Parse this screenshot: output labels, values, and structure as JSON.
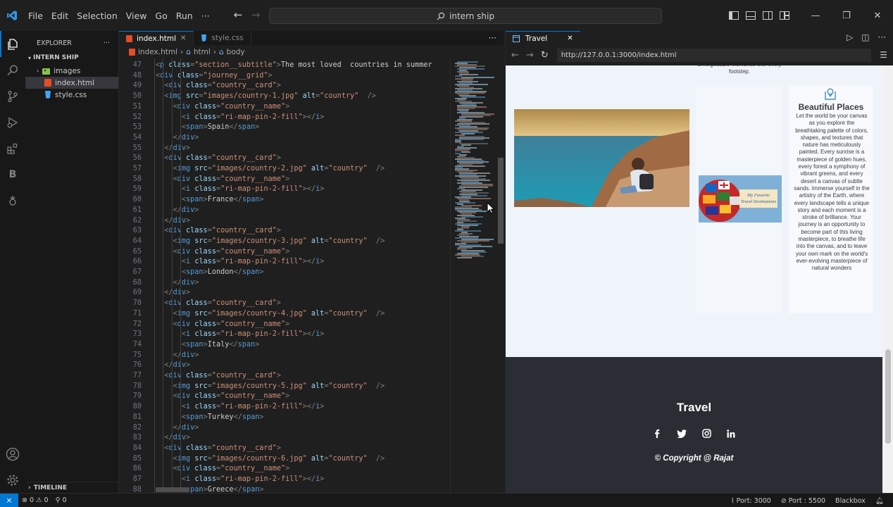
{
  "menu": [
    "File",
    "Edit",
    "Selection",
    "View",
    "Go",
    "Run",
    "···"
  ],
  "command_center": "intern ship",
  "explorer": {
    "title": "EXPLORER",
    "section": "INTERN SHIP",
    "items": [
      {
        "name": "images",
        "type": "folder"
      },
      {
        "name": "index.html",
        "type": "html"
      },
      {
        "name": "style.css",
        "type": "css"
      }
    ],
    "timeline": "TIMELINE"
  },
  "editor": {
    "tabs": [
      {
        "label": "index.html",
        "active": true
      },
      {
        "label": "style.css",
        "active": false
      }
    ],
    "breadcrumb": [
      "index.html",
      "html",
      "body"
    ],
    "lines": [
      {
        "n": "47",
        "i": 3,
        "t": "<p class=\"section__subtitle\">The most loved  countries in summer"
      },
      {
        "n": "48",
        "i": 3,
        "t": "<div class=\"journey__grid\">"
      },
      {
        "n": "49",
        "i": 4,
        "t": "<div class=\"country__card\">"
      },
      {
        "n": "50",
        "i": 4,
        "t": "<img src=\"images/country-1.jpg\" alt=\"country\" />"
      },
      {
        "n": "51",
        "i": 5,
        "t": "<div class=\"country__name\">"
      },
      {
        "n": "52",
        "i": 6,
        "t": "<i class=\"ri-map-pin-2-fill\"></i>"
      },
      {
        "n": "53",
        "i": 6,
        "t": "<span>Spain</span>"
      },
      {
        "n": "54",
        "i": 5,
        "t": "</div>"
      },
      {
        "n": "55",
        "i": 4,
        "t": "</div>"
      },
      {
        "n": "56",
        "i": 4,
        "t": "<div class=\"country__card\">"
      },
      {
        "n": "57",
        "i": 5,
        "t": "<img src=\"images/country-2.jpg\" alt=\"country\" />"
      },
      {
        "n": "58",
        "i": 5,
        "t": "<div class=\"country__name\">"
      },
      {
        "n": "59",
        "i": 6,
        "t": "<i class=\"ri-map-pin-2-fill\"></i>"
      },
      {
        "n": "60",
        "i": 6,
        "t": "<span>France</span>"
      },
      {
        "n": "61",
        "i": 5,
        "t": "</div>"
      },
      {
        "n": "62",
        "i": 4,
        "t": "</div>"
      },
      {
        "n": "63",
        "i": 4,
        "t": "<div class=\"country__card\">"
      },
      {
        "n": "64",
        "i": 5,
        "t": "<img src=\"images/country-3.jpg\" alt=\"country\" />"
      },
      {
        "n": "65",
        "i": 5,
        "t": "<div class=\"country__name\">"
      },
      {
        "n": "66",
        "i": 6,
        "t": "<i class=\"ri-map-pin-2-fill\"></i>"
      },
      {
        "n": "67",
        "i": 6,
        "t": "<span>London</span>"
      },
      {
        "n": "68",
        "i": 5,
        "t": "</div>"
      },
      {
        "n": "69",
        "i": 4,
        "t": "</div>"
      },
      {
        "n": "70",
        "i": 4,
        "t": "<div class=\"country__card\">"
      },
      {
        "n": "71",
        "i": 5,
        "t": "<img src=\"images/country-4.jpg\" alt=\"country\" />"
      },
      {
        "n": "72",
        "i": 5,
        "t": "<div class=\"country__name\">"
      },
      {
        "n": "73",
        "i": 6,
        "t": "<i class=\"ri-map-pin-2-fill\"></i>"
      },
      {
        "n": "74",
        "i": 6,
        "t": "<span>Italy</span>"
      },
      {
        "n": "75",
        "i": 5,
        "t": "</div>"
      },
      {
        "n": "76",
        "i": 4,
        "t": "</div>"
      },
      {
        "n": "77",
        "i": 4,
        "t": "<div class=\"country__card\">"
      },
      {
        "n": "78",
        "i": 5,
        "t": "<img src=\"images/country-5.jpg\" alt=\"country\" />"
      },
      {
        "n": "79",
        "i": 5,
        "t": "<div class=\"country__name\">"
      },
      {
        "n": "80",
        "i": 6,
        "t": "<i class=\"ri-map-pin-2-fill\"></i>"
      },
      {
        "n": "81",
        "i": 6,
        "t": "<span>Turkey</span>"
      },
      {
        "n": "82",
        "i": 5,
        "t": "</div>"
      },
      {
        "n": "83",
        "i": 4,
        "t": "</div>"
      },
      {
        "n": "84",
        "i": 4,
        "t": "<div class=\"country__card\">"
      },
      {
        "n": "85",
        "i": 5,
        "t": "<img src=\"images/country-6.jpg\" alt=\"country\" />"
      },
      {
        "n": "86",
        "i": 5,
        "t": "<div class=\"country__name\">"
      },
      {
        "n": "87",
        "i": 6,
        "t": "<i class=\"ri-map-pin-2-fill\"></i>"
      },
      {
        "n": "88",
        "i": 6,
        "t": "<span>Greece</span>"
      }
    ]
  },
  "browser": {
    "tab": "Travel",
    "url": "http://127.0.0.1:3000/index.html",
    "page": {
      "story_fragment": "unforgettable memories with every footstep.",
      "globe_caption": "My Favorite Travel Destinations",
      "feature_title": "Beautiful Places",
      "feature_text": "Let the world be your canvas as you explore the breathtaking palette of colors, shapes, and textures that nature has meticulously painted. Every sunrise is a masterpiece of golden hues, every forest a symphony of vibrant greens, and every desert a canvas of subtle sands. Immerse yourself in the artistry of the Earth, where every landscape tells a unique story and each moment is a stroke of brilliance. Your journey is an opportunity to become part of this living masterpiece, to breathe life into the canvas, and to leave your own mark on the world's ever-evolving masterpiece of natural wonders",
      "footer_title": "Travel",
      "footer_social": [
        "f",
        "twitter",
        "instagram",
        "in"
      ],
      "copyright": "© Copyright @ Rajat"
    }
  },
  "status": {
    "errors": "0",
    "warnings": "0",
    "ports": "0",
    "right": [
      "Port: 3000",
      "Port : 5500",
      "Blackbox"
    ]
  },
  "colors": {
    "accent": "#0078d4",
    "html_icon": "#e44d26",
    "css_icon": "#42a5f5",
    "folder_icon": "#8bc34a"
  }
}
